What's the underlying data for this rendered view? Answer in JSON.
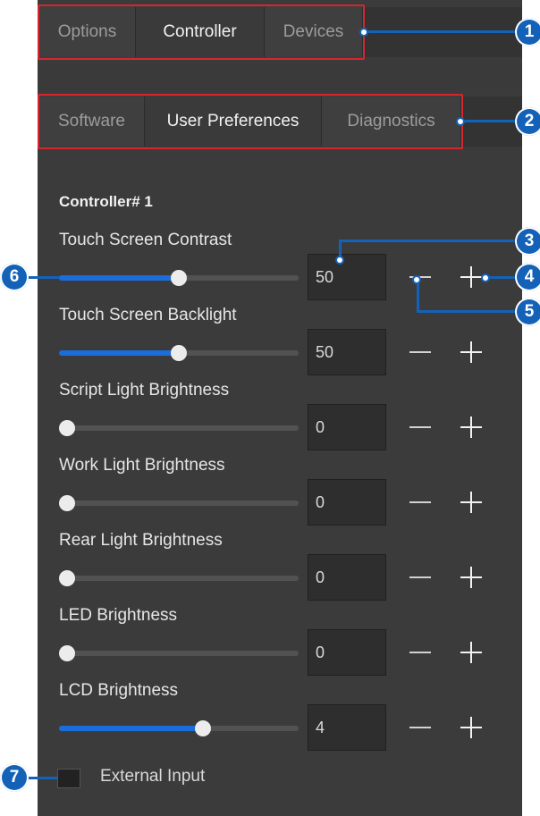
{
  "top_tabs": [
    {
      "label": "Options",
      "active": false
    },
    {
      "label": "Controller",
      "active": true
    },
    {
      "label": "Devices",
      "active": false
    }
  ],
  "sub_tabs": [
    {
      "label": "Software",
      "active": false
    },
    {
      "label": "User Preferences",
      "active": true
    },
    {
      "label": "Diagnostics",
      "active": false
    }
  ],
  "controller_title": "Controller# 1",
  "settings": [
    {
      "label": "Touch Screen Contrast",
      "value": "50",
      "level": 0.5
    },
    {
      "label": "Touch Screen Backlight",
      "value": "50",
      "level": 0.5
    },
    {
      "label": "Script Light Brightness",
      "value": "0",
      "level": 0
    },
    {
      "label": "Work Light Brightness",
      "value": "0",
      "level": 0
    },
    {
      "label": "Rear Light Brightness",
      "value": "0",
      "level": 0
    },
    {
      "label": "LED Brightness",
      "value": "0",
      "level": 0
    },
    {
      "label": "LCD Brightness",
      "value": "4",
      "level": 0.6
    }
  ],
  "external_input": {
    "label": "External Input",
    "checked": false
  },
  "callouts": [
    "1",
    "2",
    "3",
    "4",
    "5",
    "6",
    "7"
  ],
  "colors": {
    "accent": "#1a6ddb",
    "callout": "#1462b8",
    "highlight_border": "#d8262f",
    "panel": "#3b3b3b"
  }
}
